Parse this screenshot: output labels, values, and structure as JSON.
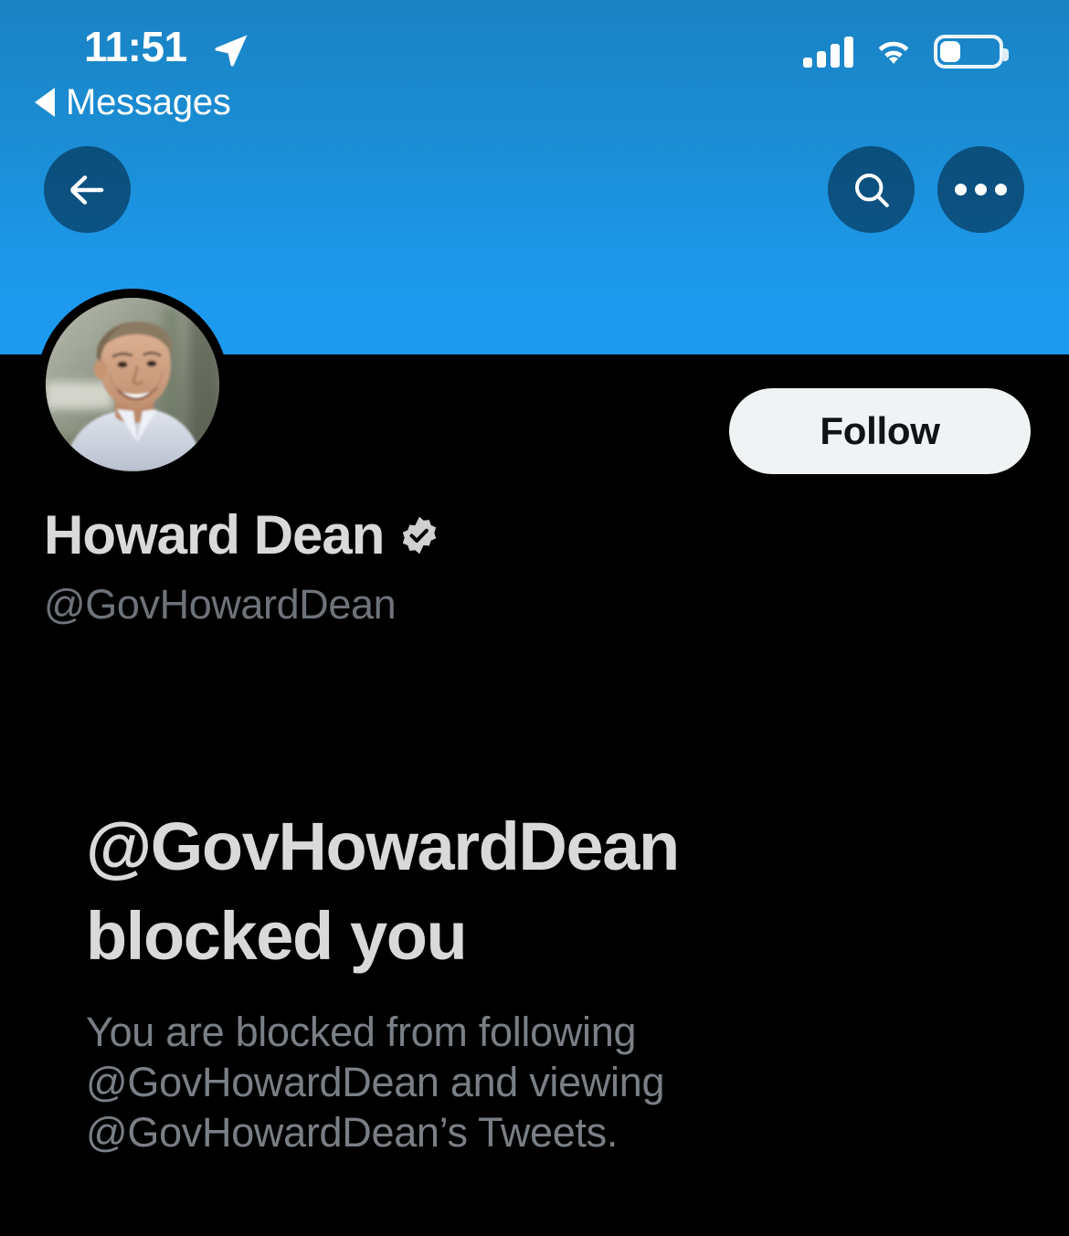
{
  "status_bar": {
    "time": "11:51",
    "location_icon": "location-arrow-icon",
    "signal_icon": "cellular-signal-icon",
    "wifi_icon": "wifi-icon",
    "battery_icon": "battery-icon",
    "battery_level_percent": "33"
  },
  "back_to_app": {
    "label": "Messages",
    "icon": "back-triangle-icon"
  },
  "header": {
    "back_icon": "arrow-left-icon",
    "search_icon": "search-icon",
    "more_icon": "more-horizontal-icon",
    "banner_color_top": "#1a83c4",
    "banner_color_bottom": "#1d9bf0"
  },
  "profile": {
    "avatar_name": "profile-avatar",
    "display_name": "Howard Dean",
    "verified_badge_icon": "verified-badge-icon",
    "handle": "@GovHowardDean",
    "follow_label": "Follow",
    "follow_button_color": "#eff3f4"
  },
  "blocked": {
    "title": "@GovHowardDean blocked you",
    "description": "You are blocked from following @GovHowardDean and viewing @GovHowardDean’s Tweets."
  },
  "theme": {
    "background": "#000000",
    "primary_text": "#d9d9d9",
    "secondary_text": "#6e7379",
    "accent": "#1d9bf0"
  }
}
